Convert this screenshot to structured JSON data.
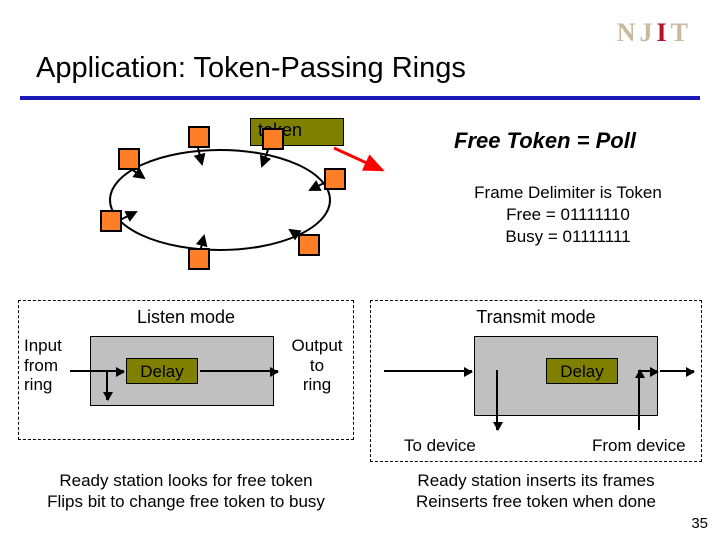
{
  "logo": {
    "full": "NJIT"
  },
  "title": "Application:  Token-Passing Rings",
  "token_label": "token",
  "heading_right": "Free Token = Poll",
  "frame_delimiter": {
    "l1": "Frame Delimiter is Token",
    "l2": "Free = 01111110",
    "l3": "Busy = 01111111"
  },
  "modes": {
    "listen": {
      "title": "Listen mode",
      "delay": "Delay",
      "input_label": "Input\nfrom\nring",
      "output_label": "Output\nto\nring",
      "caption": "Ready station looks for free token\nFlips bit to change free token to busy"
    },
    "transmit": {
      "title": "Transmit mode",
      "delay": "Delay",
      "to_device": "To device",
      "from_device": "From device",
      "caption": "Ready station inserts its frames\nReinserts free token when done"
    }
  },
  "page": "35",
  "chart_data": {
    "type": "diagram",
    "ring_stations": 7,
    "token_binary": {
      "free": "01111110",
      "busy": "01111111"
    }
  }
}
